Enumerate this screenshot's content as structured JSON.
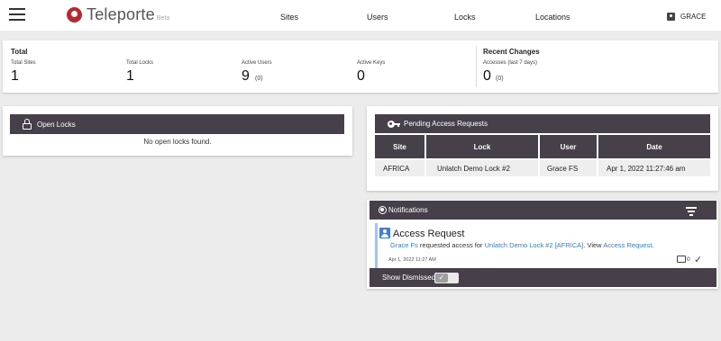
{
  "app": {
    "name": "Teleporte",
    "beta": "Beta"
  },
  "nav": {
    "sites": "Sites",
    "users": "Users",
    "locks": "Locks",
    "locations": "Locations"
  },
  "user": {
    "name": "GRACE"
  },
  "stats": {
    "total_heading": "Total",
    "total_sites_label": "Total Sites",
    "total_sites": "1",
    "total_locks_label": "Total Locks",
    "total_locks": "1",
    "active_users_label": "Active Users",
    "active_users": "9",
    "active_users_sub": "(0)",
    "active_keys_label": "Active Keys",
    "active_keys": "0",
    "recent_heading": "Recent Changes",
    "accesses_label": "Accesses (last 7 days)",
    "accesses": "0",
    "accesses_sub": "(0)"
  },
  "open_locks": {
    "title": "Open Locks",
    "empty": "No open locks found."
  },
  "pending": {
    "title": "Pending Access Requests",
    "columns": [
      "Site",
      "Lock",
      "User",
      "Date"
    ],
    "rows": [
      [
        "AFRICA",
        "Unlatch Demo Lock #2",
        "Grace FS",
        "Apr 1, 2022 11:27:46 am"
      ]
    ]
  },
  "notifications": {
    "title": "Notifications",
    "item": {
      "heading": "Access Request",
      "user_link": "Grace Fs",
      "text1": " requested access for ",
      "lock_link": "Unlatch Demo Lock #2 [AFRICA]",
      "text2": ". View ",
      "request_link": "Access Request",
      "text3": ".",
      "time": "Apr 1, 2022 11:27 AM",
      "comment_count": "0"
    },
    "show_dismissed": "Show Dismissed"
  },
  "colors": {
    "header_bar": "#47404a",
    "link": "#3a7bc8",
    "brand": "#b8282f"
  },
  "icons": [
    "menu-icon",
    "logo-icon",
    "account-icon",
    "lock-icon",
    "key-icon",
    "radio-icon",
    "filter-icon",
    "person-icon",
    "comment-icon",
    "check-icon"
  ]
}
